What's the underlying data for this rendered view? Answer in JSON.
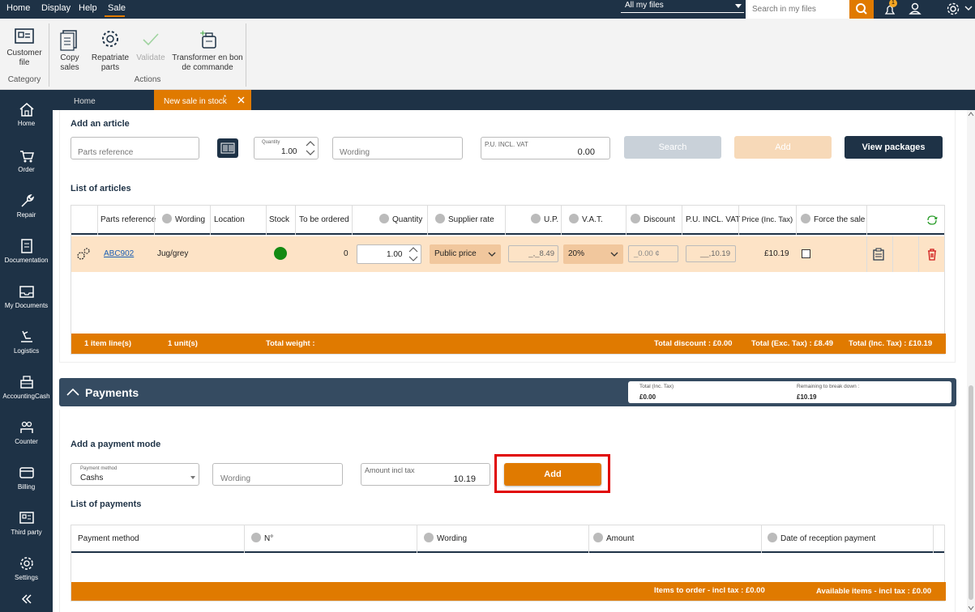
{
  "menu": {
    "home": "Home",
    "display": "Display",
    "help": "Help",
    "sale": "Sale"
  },
  "search": {
    "scope": "All my files",
    "placeholder": "Search in my files"
  },
  "notification_count": "1",
  "ribbon": {
    "customer_file": "Customer file",
    "copy_sales": "Copy sales",
    "repatriate_parts": "Repatriate parts",
    "validate": "Validate",
    "transform": "Transformer en bon de commande",
    "group_category": "Category",
    "group_actions": "Actions"
  },
  "sidebar": [
    {
      "label": "Home",
      "icon": "home-icon"
    },
    {
      "label": "Order",
      "icon": "cart-icon"
    },
    {
      "label": "Repair",
      "icon": "wrench-icon"
    },
    {
      "label": "Documentation",
      "icon": "document-icon"
    },
    {
      "label": "My Documents",
      "icon": "inbox-icon"
    },
    {
      "label": "Logistics",
      "icon": "logistics-icon"
    },
    {
      "label": "AccountingCash",
      "icon": "cash-register-icon"
    },
    {
      "label": "Counter",
      "icon": "counter-icon"
    },
    {
      "label": "Billing",
      "icon": "card-icon"
    },
    {
      "label": "Third party",
      "icon": "id-card-icon"
    },
    {
      "label": "Settings",
      "icon": "gear-icon"
    }
  ],
  "tabs": {
    "home": "Home",
    "active": "New sale in stock",
    "active_marker": "*"
  },
  "add_article": {
    "title": "Add an article",
    "parts_reference_placeholder": "Parts reference",
    "quantity_label": "Quantity",
    "quantity_value": "1.00",
    "wording_placeholder": "Wording",
    "pu_label": "P.U. INCL. VAT",
    "pu_value": "0.00",
    "search_button": "Search",
    "add_button": "Add",
    "view_packages_button": "View packages"
  },
  "articles": {
    "title": "List of articles",
    "columns": [
      "Parts reference",
      "Wording",
      "Location",
      "Stock",
      "To be ordered",
      "Quantity",
      "Supplier rate",
      "U.P.",
      "V.A.T.",
      "Discount",
      "P.U. INCL. VAT",
      "Price (Inc. Tax)",
      "Force the sale"
    ],
    "row": {
      "reference": "ABC902",
      "wording": "Jug/grey",
      "location": "",
      "to_be_ordered": "0",
      "quantity": "1.00",
      "supplier_rate": "Public price",
      "up": "_,_8.49",
      "vat": "20%",
      "discount": "_0.00 ¢",
      "pu_incl_vat": "__,10.19",
      "price_inc_tax": "£10.19"
    },
    "summary": {
      "item_lines": "1 item line(s)",
      "units": "1 unit(s)",
      "weight": "Total weight :",
      "discount": "Total discount : £0.00",
      "exc_tax": "Total (Exc. Tax) : £8.49",
      "inc_tax": "Total (Inc. Tax) : £10.19"
    }
  },
  "payments": {
    "title": "Payments",
    "total_label": "Total (Inc. Tax)",
    "total_value": "£0.00",
    "remaining_label": "Remaining to break down :",
    "remaining_value": "£10.19",
    "add_mode_title": "Add a payment mode",
    "method_label": "Payment method",
    "method_value": "Cashs",
    "wording_placeholder": "Wording",
    "amount_label": "Amount incl tax",
    "amount_value": "10.19",
    "add_button": "Add",
    "list_title": "List of payments",
    "columns": [
      "Payment method",
      "N°",
      "Wording",
      "Amount",
      "Date of reception payment"
    ],
    "footer_left": "Items to order - incl tax : £0.00",
    "footer_right": "Available items - incl tax : £0.00"
  },
  "colors": {
    "navy": "#1e3246",
    "orange": "#e07a00",
    "row_highlight": "#fde3c6",
    "highlight_box": "#e00000"
  }
}
